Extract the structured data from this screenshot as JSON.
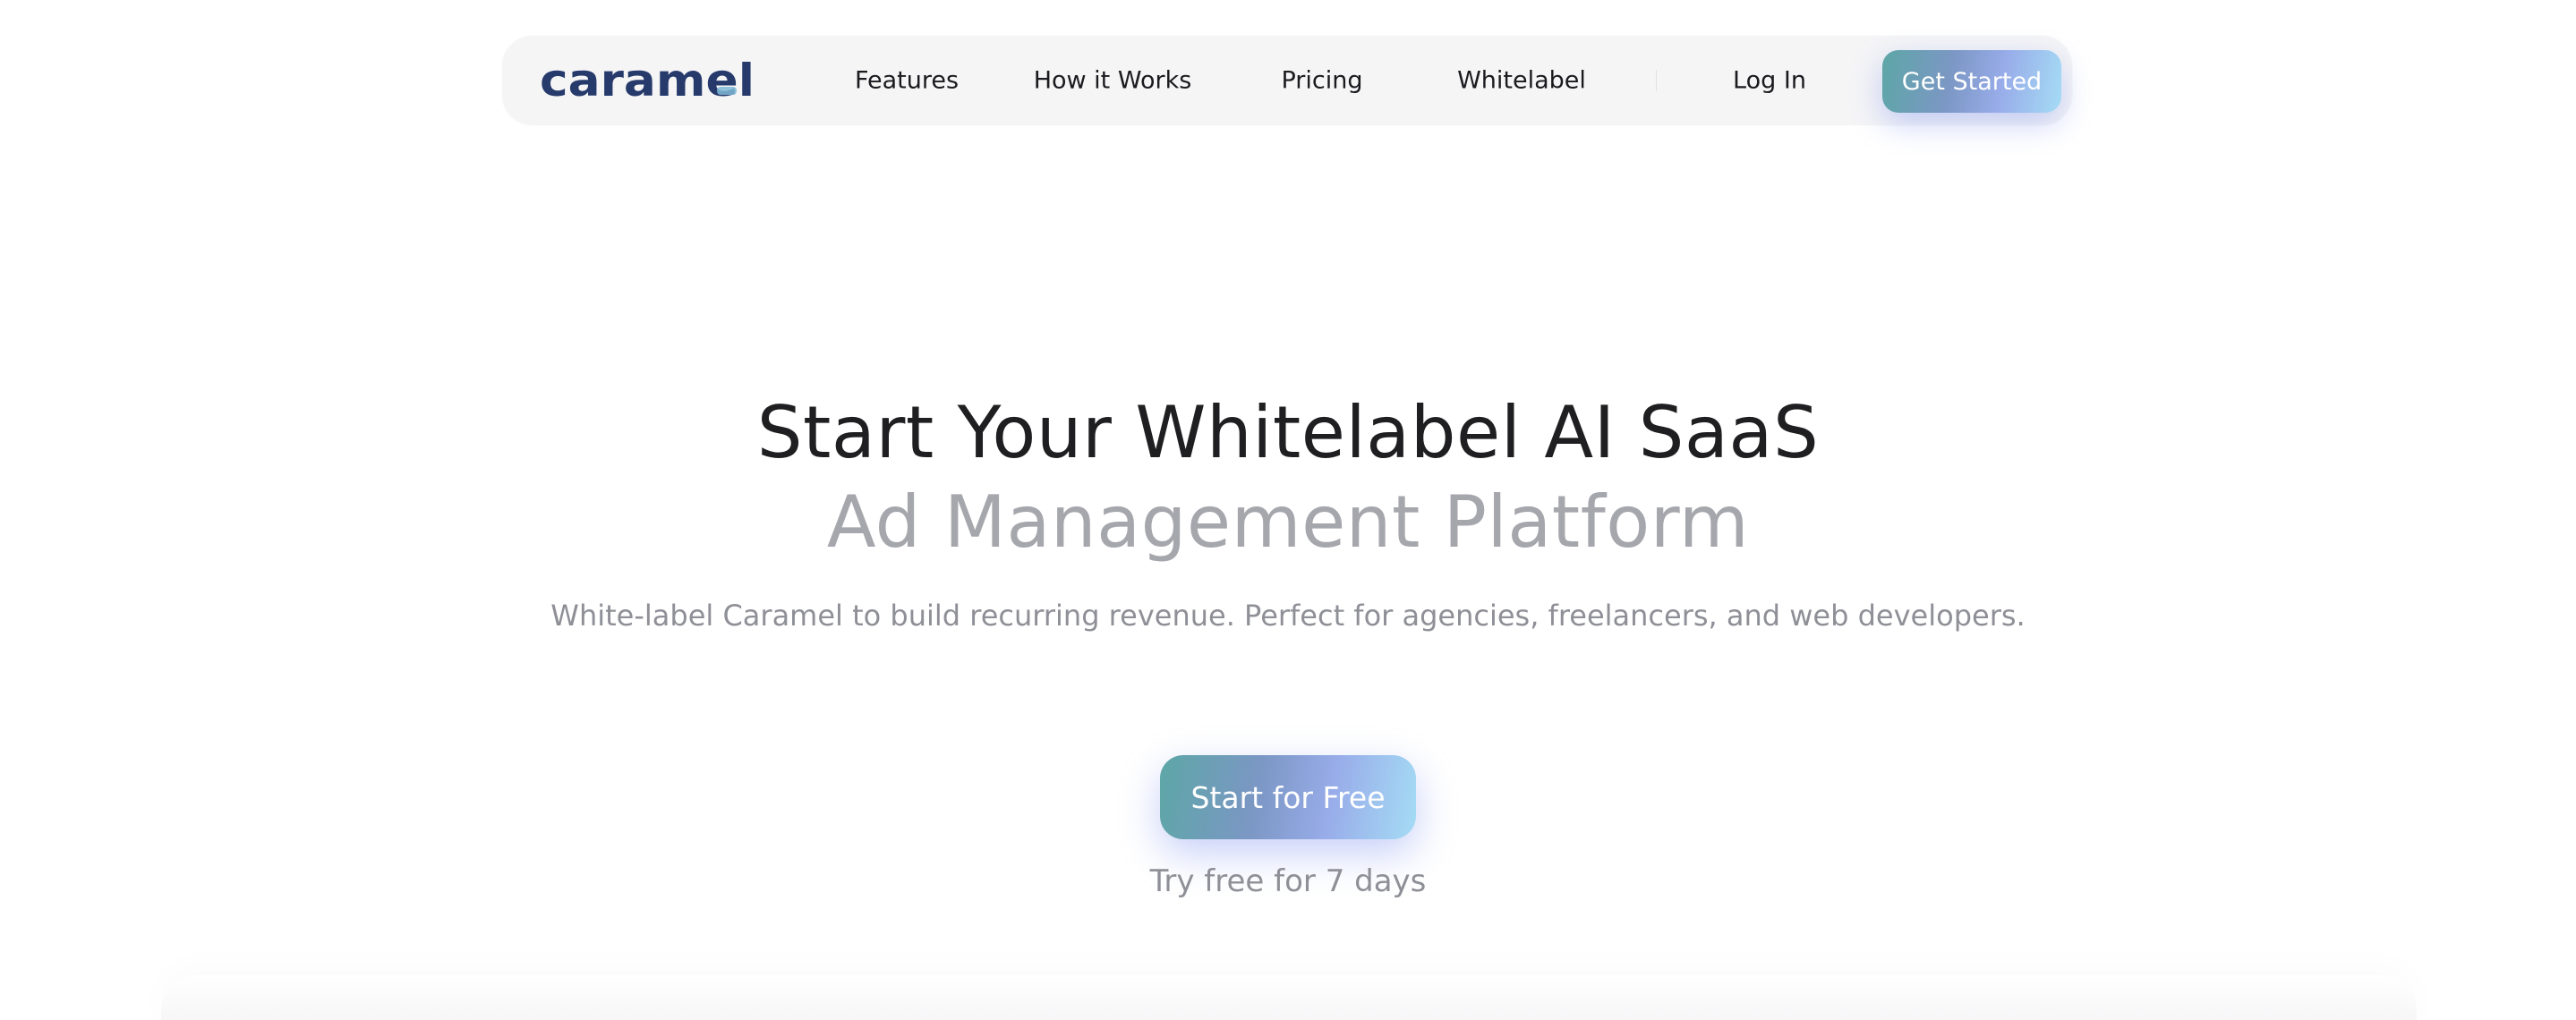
{
  "brand": {
    "logo_text": "caramel",
    "primary_color": "#263a6b",
    "accent_gradient": [
      "#5da7a6",
      "#7b97c4",
      "#98ace9",
      "#a5dcf5"
    ]
  },
  "nav": {
    "links": [
      "Features",
      "How it Works",
      "Pricing",
      "Whitelabel"
    ],
    "login_label": "Log In",
    "get_started_label": "Get Started"
  },
  "hero": {
    "title_line1": "Start Your Whitelabel AI SaaS",
    "title_line2": "Ad Management Platform",
    "subtitle": "White-label Caramel to build recurring revenue. Perfect for agencies, freelancers, and web developers.",
    "cta_label": "Start for Free",
    "trial_note": "Try free for 7 days"
  }
}
